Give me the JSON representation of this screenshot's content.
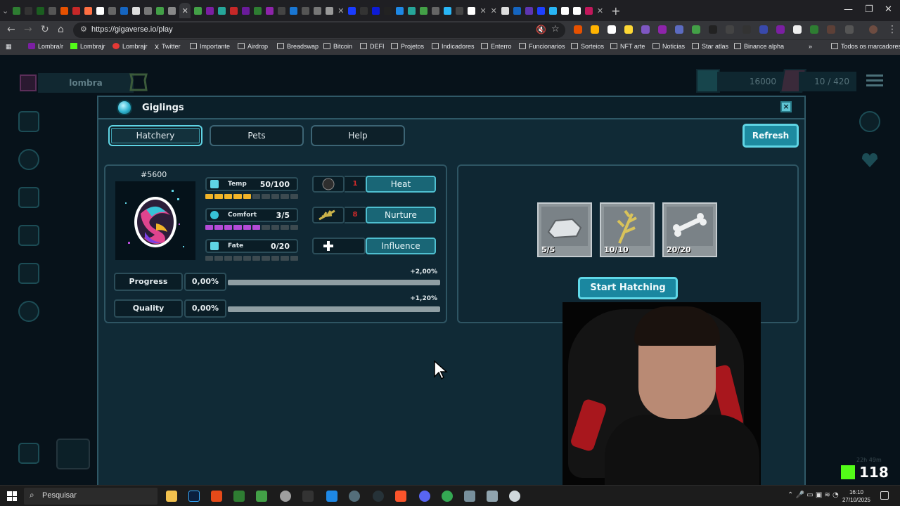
{
  "browser": {
    "url": "https://gigaverse.io/play",
    "bookmarks": [
      "Lombra/r",
      "Lombrajr",
      "Lombrajr",
      "Twitter",
      "Importante",
      "Airdrop",
      "Breadswap",
      "Bitcoin",
      "DEFI",
      "Projetos",
      "Indicadores",
      "Enterro",
      "Funcionarios",
      "Sorteios",
      "NFT arte",
      "Noticias",
      "Star atlas",
      "Binance alpha"
    ],
    "all_bookmarks": "Todos os marcadores"
  },
  "hud": {
    "username": "lombra",
    "gold": "16000",
    "energy": "10 / 420"
  },
  "modal": {
    "title": "Giglings",
    "tabs": [
      "Hatchery",
      "Pets",
      "Help"
    ],
    "active_tab": "Hatchery",
    "refresh": "Refresh",
    "close": "×"
  },
  "egg": {
    "id": "#5600",
    "stats": [
      {
        "label": "Temp",
        "value": "50/100",
        "level": 0.5,
        "color": "#f0b429"
      },
      {
        "label": "Comfort",
        "value": "3/5",
        "level": 0.6,
        "color": "#b44bd6"
      },
      {
        "label": "Fate",
        "value": "0/20",
        "level": 0.0,
        "color": "#3c4a50"
      }
    ],
    "actions": [
      {
        "label": "Heat",
        "cost": "1"
      },
      {
        "label": "Nurture",
        "cost": "8"
      },
      {
        "label": "Influence",
        "cost": ""
      }
    ],
    "progress": {
      "label": "Progress",
      "value": "0,00%",
      "delta": "+2,00%",
      "level": 0.0
    },
    "quality": {
      "label": "Quality",
      "value": "0,00%",
      "delta": "+1,20%",
      "level": 0.0
    }
  },
  "hatch": {
    "requirements": [
      "5/5",
      "10/10",
      "20/20"
    ],
    "start": "Start Hatching"
  },
  "stream": {
    "viewers": "118",
    "timer": "22h 49m"
  },
  "taskbar": {
    "search_placeholder": "Pesquisar",
    "time": "16:10",
    "date": "27/10/2025"
  }
}
